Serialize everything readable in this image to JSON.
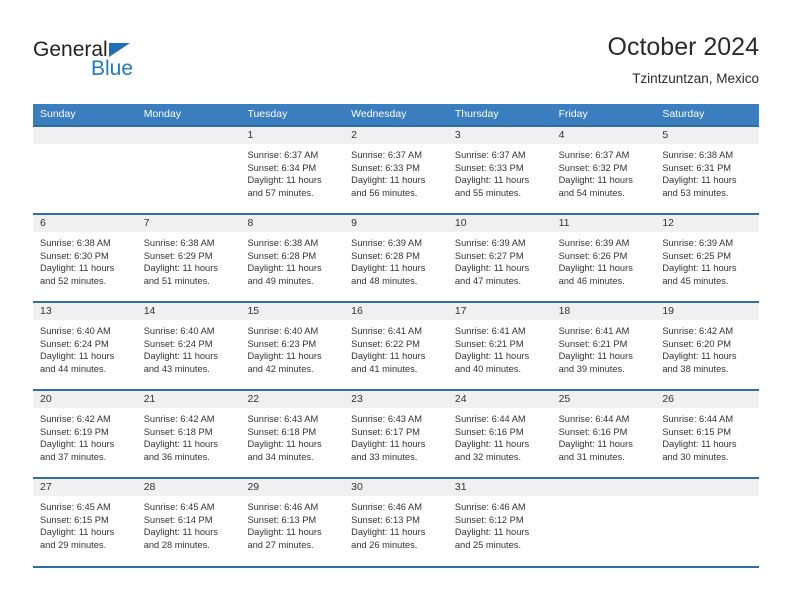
{
  "brand": {
    "name_part1": "General",
    "name_part2": "Blue",
    "accent_color": "#1f7ac4",
    "triangle_color": "#1f6fb5"
  },
  "header": {
    "title": "October 2024",
    "subtitle": "Tzintzuntzan, Mexico"
  },
  "theme": {
    "header_row_bg": "#3a7ebf",
    "row_divider": "#2e6da4",
    "date_band_bg": "#f0f0f0"
  },
  "weekdays": [
    "Sunday",
    "Monday",
    "Tuesday",
    "Wednesday",
    "Thursday",
    "Friday",
    "Saturday"
  ],
  "weeks": [
    [
      {
        "day": "",
        "sunrise": "",
        "sunset": "",
        "daylight": ""
      },
      {
        "day": "",
        "sunrise": "",
        "sunset": "",
        "daylight": ""
      },
      {
        "day": "1",
        "sunrise": "Sunrise: 6:37 AM",
        "sunset": "Sunset: 6:34 PM",
        "daylight": "Daylight: 11 hours and 57 minutes."
      },
      {
        "day": "2",
        "sunrise": "Sunrise: 6:37 AM",
        "sunset": "Sunset: 6:33 PM",
        "daylight": "Daylight: 11 hours and 56 minutes."
      },
      {
        "day": "3",
        "sunrise": "Sunrise: 6:37 AM",
        "sunset": "Sunset: 6:33 PM",
        "daylight": "Daylight: 11 hours and 55 minutes."
      },
      {
        "day": "4",
        "sunrise": "Sunrise: 6:37 AM",
        "sunset": "Sunset: 6:32 PM",
        "daylight": "Daylight: 11 hours and 54 minutes."
      },
      {
        "day": "5",
        "sunrise": "Sunrise: 6:38 AM",
        "sunset": "Sunset: 6:31 PM",
        "daylight": "Daylight: 11 hours and 53 minutes."
      }
    ],
    [
      {
        "day": "6",
        "sunrise": "Sunrise: 6:38 AM",
        "sunset": "Sunset: 6:30 PM",
        "daylight": "Daylight: 11 hours and 52 minutes."
      },
      {
        "day": "7",
        "sunrise": "Sunrise: 6:38 AM",
        "sunset": "Sunset: 6:29 PM",
        "daylight": "Daylight: 11 hours and 51 minutes."
      },
      {
        "day": "8",
        "sunrise": "Sunrise: 6:38 AM",
        "sunset": "Sunset: 6:28 PM",
        "daylight": "Daylight: 11 hours and 49 minutes."
      },
      {
        "day": "9",
        "sunrise": "Sunrise: 6:39 AM",
        "sunset": "Sunset: 6:28 PM",
        "daylight": "Daylight: 11 hours and 48 minutes."
      },
      {
        "day": "10",
        "sunrise": "Sunrise: 6:39 AM",
        "sunset": "Sunset: 6:27 PM",
        "daylight": "Daylight: 11 hours and 47 minutes."
      },
      {
        "day": "11",
        "sunrise": "Sunrise: 6:39 AM",
        "sunset": "Sunset: 6:26 PM",
        "daylight": "Daylight: 11 hours and 46 minutes."
      },
      {
        "day": "12",
        "sunrise": "Sunrise: 6:39 AM",
        "sunset": "Sunset: 6:25 PM",
        "daylight": "Daylight: 11 hours and 45 minutes."
      }
    ],
    [
      {
        "day": "13",
        "sunrise": "Sunrise: 6:40 AM",
        "sunset": "Sunset: 6:24 PM",
        "daylight": "Daylight: 11 hours and 44 minutes."
      },
      {
        "day": "14",
        "sunrise": "Sunrise: 6:40 AM",
        "sunset": "Sunset: 6:24 PM",
        "daylight": "Daylight: 11 hours and 43 minutes."
      },
      {
        "day": "15",
        "sunrise": "Sunrise: 6:40 AM",
        "sunset": "Sunset: 6:23 PM",
        "daylight": "Daylight: 11 hours and 42 minutes."
      },
      {
        "day": "16",
        "sunrise": "Sunrise: 6:41 AM",
        "sunset": "Sunset: 6:22 PM",
        "daylight": "Daylight: 11 hours and 41 minutes."
      },
      {
        "day": "17",
        "sunrise": "Sunrise: 6:41 AM",
        "sunset": "Sunset: 6:21 PM",
        "daylight": "Daylight: 11 hours and 40 minutes."
      },
      {
        "day": "18",
        "sunrise": "Sunrise: 6:41 AM",
        "sunset": "Sunset: 6:21 PM",
        "daylight": "Daylight: 11 hours and 39 minutes."
      },
      {
        "day": "19",
        "sunrise": "Sunrise: 6:42 AM",
        "sunset": "Sunset: 6:20 PM",
        "daylight": "Daylight: 11 hours and 38 minutes."
      }
    ],
    [
      {
        "day": "20",
        "sunrise": "Sunrise: 6:42 AM",
        "sunset": "Sunset: 6:19 PM",
        "daylight": "Daylight: 11 hours and 37 minutes."
      },
      {
        "day": "21",
        "sunrise": "Sunrise: 6:42 AM",
        "sunset": "Sunset: 6:18 PM",
        "daylight": "Daylight: 11 hours and 36 minutes."
      },
      {
        "day": "22",
        "sunrise": "Sunrise: 6:43 AM",
        "sunset": "Sunset: 6:18 PM",
        "daylight": "Daylight: 11 hours and 34 minutes."
      },
      {
        "day": "23",
        "sunrise": "Sunrise: 6:43 AM",
        "sunset": "Sunset: 6:17 PM",
        "daylight": "Daylight: 11 hours and 33 minutes."
      },
      {
        "day": "24",
        "sunrise": "Sunrise: 6:44 AM",
        "sunset": "Sunset: 6:16 PM",
        "daylight": "Daylight: 11 hours and 32 minutes."
      },
      {
        "day": "25",
        "sunrise": "Sunrise: 6:44 AM",
        "sunset": "Sunset: 6:16 PM",
        "daylight": "Daylight: 11 hours and 31 minutes."
      },
      {
        "day": "26",
        "sunrise": "Sunrise: 6:44 AM",
        "sunset": "Sunset: 6:15 PM",
        "daylight": "Daylight: 11 hours and 30 minutes."
      }
    ],
    [
      {
        "day": "27",
        "sunrise": "Sunrise: 6:45 AM",
        "sunset": "Sunset: 6:15 PM",
        "daylight": "Daylight: 11 hours and 29 minutes."
      },
      {
        "day": "28",
        "sunrise": "Sunrise: 6:45 AM",
        "sunset": "Sunset: 6:14 PM",
        "daylight": "Daylight: 11 hours and 28 minutes."
      },
      {
        "day": "29",
        "sunrise": "Sunrise: 6:46 AM",
        "sunset": "Sunset: 6:13 PM",
        "daylight": "Daylight: 11 hours and 27 minutes."
      },
      {
        "day": "30",
        "sunrise": "Sunrise: 6:46 AM",
        "sunset": "Sunset: 6:13 PM",
        "daylight": "Daylight: 11 hours and 26 minutes."
      },
      {
        "day": "31",
        "sunrise": "Sunrise: 6:46 AM",
        "sunset": "Sunset: 6:12 PM",
        "daylight": "Daylight: 11 hours and 25 minutes."
      },
      {
        "day": "",
        "sunrise": "",
        "sunset": "",
        "daylight": ""
      },
      {
        "day": "",
        "sunrise": "",
        "sunset": "",
        "daylight": ""
      }
    ]
  ]
}
